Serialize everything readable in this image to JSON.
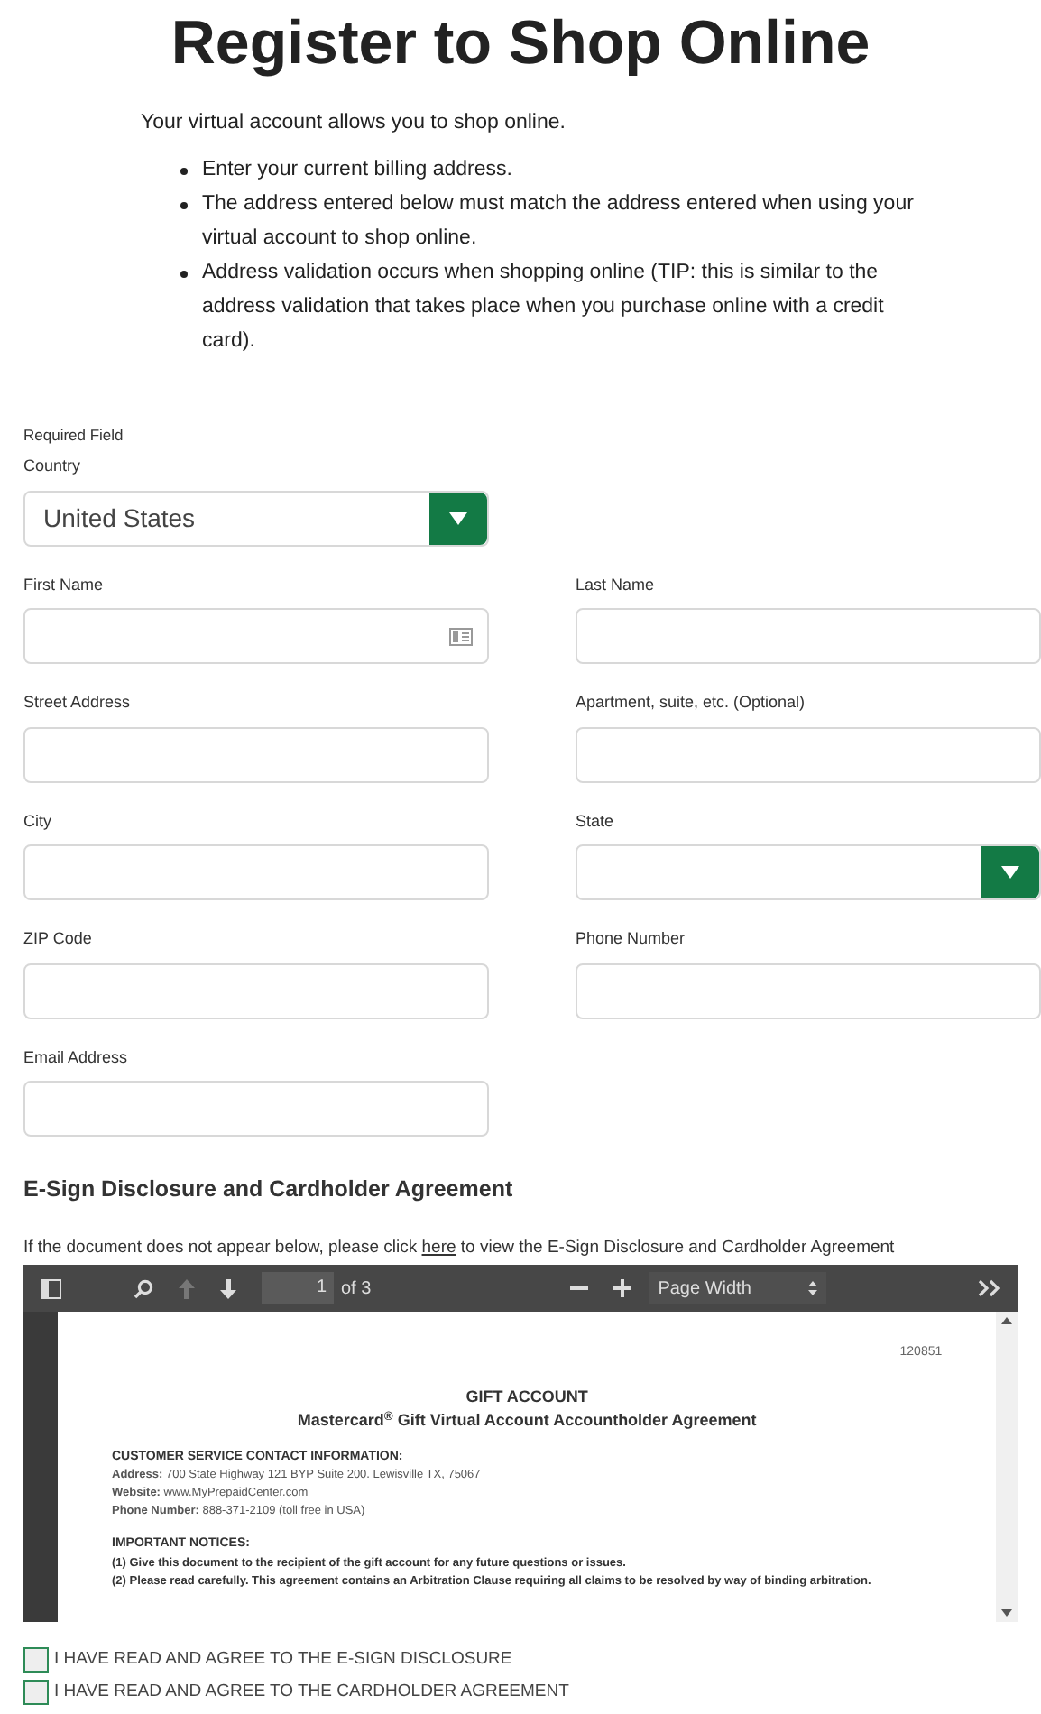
{
  "title": "Register to Shop Online",
  "intro": "Your virtual account allows you to shop online.",
  "bullets": [
    "Enter your current billing address.",
    "The address entered below must match the address entered when using your virtual account to shop online.",
    "Address validation occurs when shopping online (TIP: this is similar to the address validation that takes place when you purchase online with a credit card)."
  ],
  "required_label": "Required Field",
  "rows": [
    [
      {
        "kind": "select",
        "label": "Country",
        "value": "United States"
      }
    ],
    [
      {
        "kind": "contact_text",
        "label": "First Name"
      },
      {
        "kind": "text",
        "label": "Last Name"
      }
    ],
    [
      {
        "kind": "text",
        "label": "Street Address"
      },
      {
        "kind": "text",
        "label": "Apartment, suite, etc. (Optional)"
      }
    ],
    [
      {
        "kind": "text",
        "label": "City"
      },
      {
        "kind": "select",
        "label": "State"
      }
    ],
    [
      {
        "kind": "text",
        "label": "ZIP Code"
      },
      {
        "kind": "text",
        "label": "Phone Number"
      }
    ],
    [
      {
        "kind": "text",
        "label": "Email Address"
      }
    ]
  ],
  "agreement": {
    "heading": "E-Sign Disclosure and Cardholder Agreement",
    "note_before": "If the document does not appear below, please click",
    "link": "here",
    "note_after": "to view the E-Sign Disclosure and Cardholder Agreement",
    "viewer": {
      "page": "1",
      "page_count": "of 3",
      "zoom": "Page Width",
      "doc": {
        "number": "120851",
        "heading": "GIFT ACCOUNT",
        "subheading": "Mastercard$^{®}$ Gift Virtual Account Accountholder Agreement",
        "contact_heading": "CUSTOMER SERVICE CONTACT INFORMATION:",
        "contact_lines": [
          "**Address:** 700 State Highway 121 BYP Suite 200. Lewisville TX, 75067",
          "**Website:** www.MyPrepaidCenter.com",
          "**Phone Number:** 888-371-2109  (toll free in USA)"
        ],
        "notices_heading": "IMPORTANT NOTICES:",
        "notices": [
          "(1) Give this document to the recipient of the gift account for any future questions or issues.",
          "(2) Please read carefully. This agreement contains an Arbitration Clause requiring all claims to be resolved by way of binding arbitration."
        ]
      }
    }
  },
  "checkboxes": [
    {
      "label": "I HAVE READ AND AGREE TO THE E-SIGN DISCLOSURE",
      "checked": false
    },
    {
      "label": "I HAVE READ AND AGREE TO THE CARDHOLDER AGREEMENT",
      "checked": false
    }
  ]
}
